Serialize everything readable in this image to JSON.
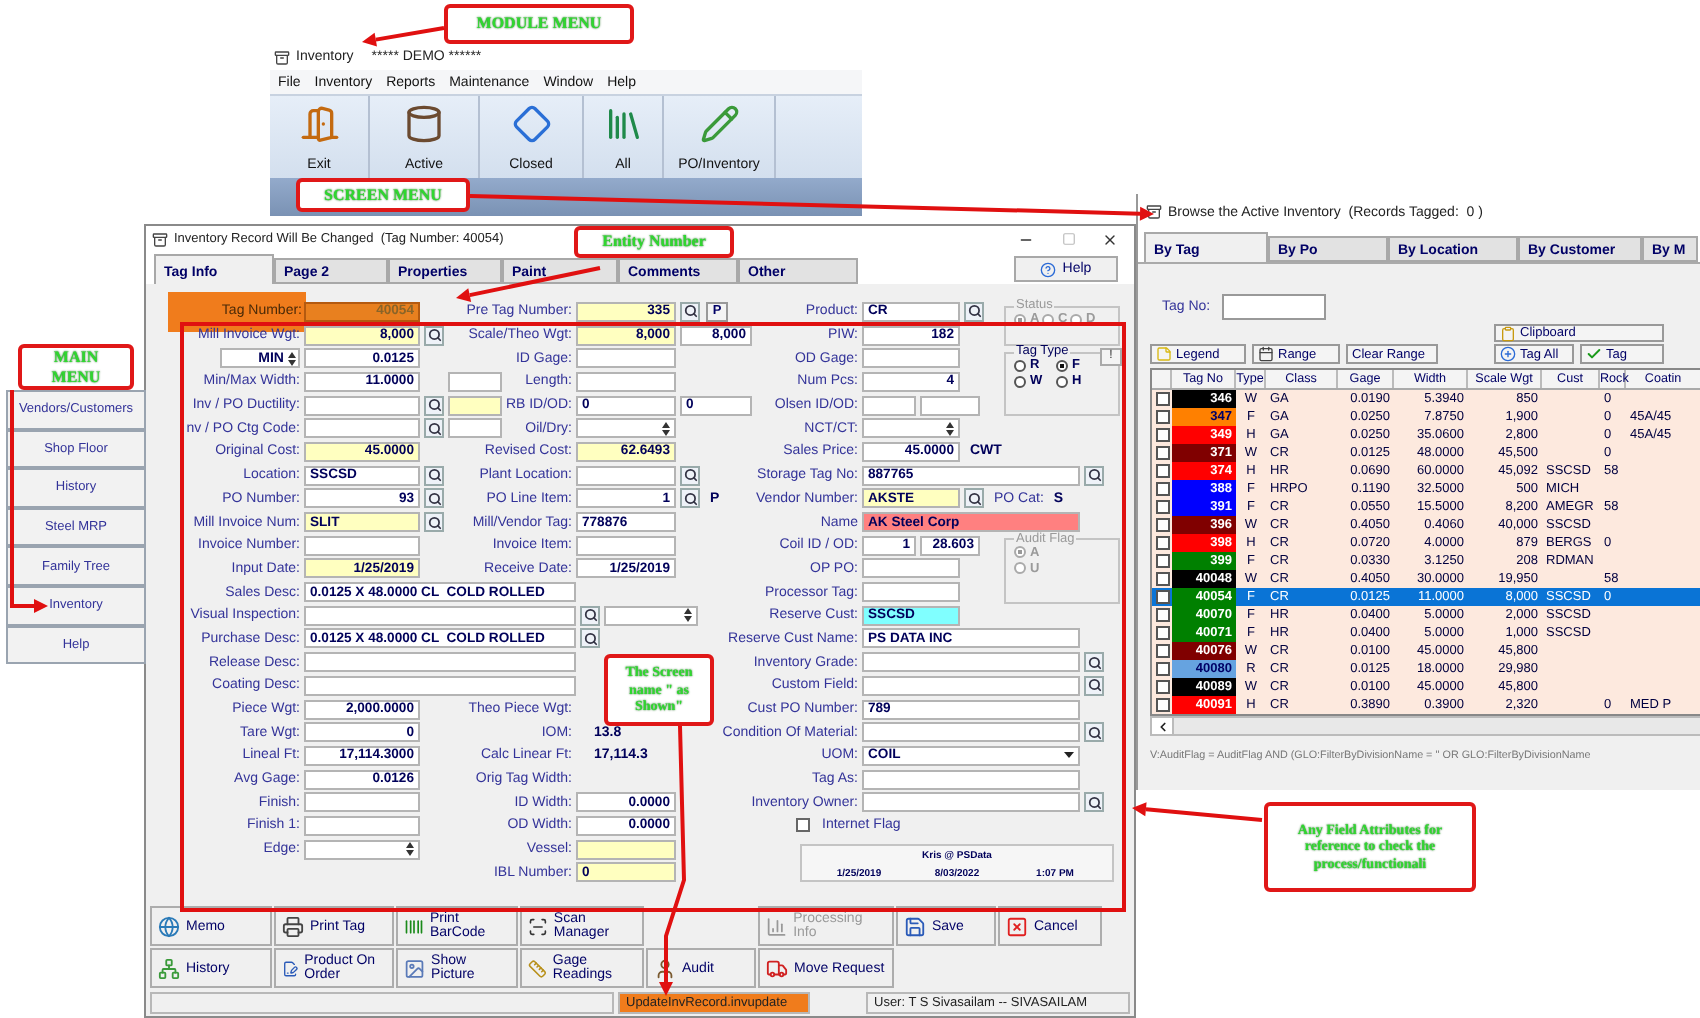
{
  "annotations": [
    {
      "text": "MODULE MENU"
    },
    {
      "text": "SCREEN MENU"
    },
    {
      "text": "Entity Number"
    },
    {
      "text": "MAIN MENU"
    },
    {
      "text": "The Screen name \" as Shown\""
    },
    {
      "text": "Any Field Attributes for reference to check the process/functionali"
    }
  ],
  "module_window": {
    "title": "Inventory",
    "subtitle": "***** DEMO ******",
    "menu": [
      "File",
      "Inventory",
      "Reports",
      "Maintenance",
      "Window",
      "Help"
    ],
    "toolbar": [
      "Exit",
      "Active",
      "Closed",
      "All",
      "PO/Inventory"
    ]
  },
  "main_menu": [
    "Vendors/Customers",
    "Shop Floor",
    "History",
    "Steel MRP",
    "Family Tree",
    "Inventory",
    "Help"
  ],
  "form": {
    "title": "Inventory Record Will Be Changed  (Tag Number: 40054)",
    "tabs": [
      {
        "label": "Tag Info",
        "selected": true
      },
      {
        "label": "Page 2",
        "selected": false
      },
      {
        "label": "Properties",
        "selected": false
      },
      {
        "label": "Paint",
        "selected": false
      },
      {
        "label": "Comments",
        "selected": false
      },
      {
        "label": "Other",
        "selected": false
      }
    ],
    "help": "Help",
    "rows": [
      {
        "left": {
          "label": "Tag Number:",
          "value": "40054",
          "kind": "tag"
        },
        "middle": {
          "label": "Pre Tag Number:",
          "value": "335",
          "kind": "number",
          "color": "#ffffc0",
          "lookup": true,
          "button": "P"
        },
        "right": {
          "label": "Product:",
          "value": "CR",
          "kind": "text",
          "lookup": true
        }
      },
      {
        "left": {
          "label": "Mill Invoice Wgt:",
          "value": "8,000",
          "kind": "number",
          "color": "#ffffc0",
          "lookup": true
        },
        "middle": {
          "label": "Scale/Theo Wgt:",
          "value": "8,000",
          "kind": "number",
          "color": "#ffffc0",
          "second": {
            "value": "8,000",
            "kind": "number"
          }
        },
        "right": {
          "label": "PIW:",
          "value": "182",
          "kind": "number"
        }
      },
      {
        "left": {
          "selector": "MIN",
          "value": "0.0125",
          "kind": "number"
        },
        "middle": {
          "label": "ID Gage:",
          "kind": "text"
        },
        "right": {
          "label": "OD Gage:",
          "kind": "text"
        }
      },
      {
        "left": {
          "label": "Min/Max Width:",
          "value": "11.0000",
          "kind": "number",
          "second": {
            "kind": "text"
          }
        },
        "middle": {
          "label": "Length:",
          "kind": "text"
        },
        "right": {
          "label": "Num Pcs:",
          "value": "4",
          "kind": "number"
        }
      },
      {
        "left": {
          "label": "Inv / PO Ductility:",
          "kind": "text",
          "lookup": true,
          "second": {
            "kind": "text",
            "color": "#ffffc0"
          }
        },
        "middle": {
          "label": "RB ID/OD:",
          "value": "0",
          "kind": "text",
          "second": {
            "value": "0",
            "kind": "text"
          }
        },
        "right": {
          "label": "Olsen ID/OD:",
          "kind": "text",
          "second": {
            "kind": "text"
          }
        }
      },
      {
        "left": {
          "label": "nv / PO Ctg Code:",
          "kind": "text",
          "lookup": true,
          "second": {
            "kind": "text"
          }
        },
        "middle": {
          "label": "Oil/Dry:",
          "kind": "spin"
        },
        "right": {
          "label": "NCT/CT:",
          "kind": "spin"
        }
      },
      {
        "left": {
          "label": "Original Cost:",
          "value": "45.0000",
          "kind": "number",
          "color": "#ffffc0"
        },
        "middle": {
          "label": "Revised Cost:",
          "value": "62.6493",
          "kind": "number",
          "color": "#ffffc0"
        },
        "right": {
          "label": "Sales Price:",
          "value": "45.0000",
          "kind": "number",
          "suffixes": [
            {
              "text": "CWT",
              "kind": "value"
            }
          ]
        }
      },
      {
        "left": {
          "label": "Location:",
          "value": "SSCSD",
          "kind": "text",
          "lookup": true
        },
        "middle": {
          "label": "Plant Location:",
          "kind": "text",
          "lookup": true
        },
        "right": {
          "label": "Storage Tag No:",
          "value": "887765",
          "kind": "long",
          "lookup": true
        }
      },
      {
        "left": {
          "label": "PO Number:",
          "value": "93",
          "kind": "number",
          "lookup": true
        },
        "middle": {
          "label": "PO Line Item:",
          "value": "1",
          "kind": "number",
          "lookup": true,
          "suffixes": [
            {
              "text": "P",
              "kind": "value"
            }
          ]
        },
        "right": {
          "label": "Vendor Number:",
          "value": "AKSTE",
          "kind": "text",
          "color": "#ffffc0",
          "lookup": true,
          "suffixes": [
            {
              "text": "PO Cat:",
              "kind": "label"
            },
            {
              "text": "S",
              "kind": "value"
            }
          ]
        }
      },
      {
        "left": {
          "label": "Mill Invoice Num:",
          "value": "SLIT",
          "kind": "text",
          "color": "#ffffc0",
          "lookup": true
        },
        "middle": {
          "label": "Mill/Vendor Tag:",
          "value": "778876",
          "kind": "text"
        },
        "right": {
          "label": "Name",
          "value": "AK Steel Corp",
          "kind": "long",
          "color": "#ff8080"
        }
      },
      {
        "left": {
          "label": "Invoice Number:",
          "kind": "text"
        },
        "middle": {
          "label": "Invoice Item:",
          "kind": "text"
        },
        "right": {
          "label": "Coil ID / OD:",
          "value": "1",
          "kind": "number",
          "second": {
            "value": "28.603",
            "kind": "number"
          }
        }
      },
      {
        "left": {
          "label": "Input Date:",
          "value": "1/25/2019",
          "kind": "number",
          "color": "#ffffc0"
        },
        "middle": {
          "label": "Receive Date:",
          "value": "1/25/2019",
          "kind": "number"
        },
        "right": {
          "label": "OP PO:",
          "kind": "text"
        }
      },
      {
        "left": {
          "label": "Sales Desc:",
          "value": "0.0125 X 48.0000 CL  COLD ROLLED",
          "kind": "wide"
        },
        "right": {
          "label": "Processor Tag:",
          "kind": "text"
        }
      },
      {
        "left": {
          "label": "Visual Inspection:",
          "kind": "wide",
          "lookup": true,
          "second": {
            "kind": "spin"
          }
        },
        "right": {
          "label": "Reserve Cust:",
          "value": "SSCSD",
          "kind": "text",
          "color": "#80ffff"
        }
      },
      {
        "left": {
          "label": "Purchase Desc:",
          "value": "0.0125 X 48.0000 CL  COLD ROLLED",
          "kind": "wide",
          "lookup": true
        },
        "right": {
          "label": "Reserve Cust Name:",
          "value": "PS DATA INC",
          "kind": "long"
        }
      },
      {
        "left": {
          "label": "Release Desc:",
          "kind": "wide"
        },
        "right": {
          "label": "Inventory Grade:",
          "kind": "long",
          "lookup": true
        }
      },
      {
        "left": {
          "label": "Coating Desc:",
          "kind": "wide"
        },
        "right": {
          "label": "Custom Field:",
          "kind": "long",
          "lookup": true
        }
      },
      {
        "left": {
          "label": "Piece Wgt:",
          "value": "2,000.0000",
          "kind": "number"
        },
        "middle": {
          "label": "Theo Piece Wgt:",
          "kind": "plain"
        },
        "right": {
          "label": "Cust PO Number:",
          "value": "789",
          "kind": "long"
        }
      },
      {
        "left": {
          "label": "Tare Wgt:",
          "value": "0",
          "kind": "number"
        },
        "middle": {
          "label": "IOM:",
          "value": "13.8",
          "kind": "plain"
        },
        "right": {
          "label": "Condition Of Material:",
          "kind": "long",
          "lookup": true
        }
      },
      {
        "left": {
          "label": "Lineal Ft:",
          "value": "17,114.3000",
          "kind": "number"
        },
        "middle": {
          "label": "Calc Linear Ft:",
          "value": "17,114.3",
          "kind": "plain"
        },
        "right": {
          "label": "UOM:",
          "value": "COIL",
          "kind": "combo"
        }
      },
      {
        "left": {
          "label": "Avg Gage:",
          "value": "0.0126",
          "kind": "number"
        },
        "middle": {
          "label": "Orig Tag Width:",
          "kind": "plain"
        },
        "right": {
          "label": "Tag As:",
          "kind": "long"
        }
      },
      {
        "left": {
          "label": "Finish:",
          "kind": "text"
        },
        "middle": {
          "label": "ID Width:",
          "value": "0.0000",
          "kind": "number"
        },
        "right": {
          "label": "Inventory Owner:",
          "kind": "long",
          "lookup": true
        }
      },
      {
        "left": {
          "label": "Finish 1:",
          "kind": "text"
        },
        "middle": {
          "label": "OD Width:",
          "value": "0.0000",
          "kind": "number"
        },
        "right": {
          "label": "Internet Flag",
          "kind": "check",
          "checked": false
        }
      },
      {
        "left": {
          "label": "Edge:",
          "kind": "spin"
        },
        "middle": {
          "label": "Vessel:",
          "kind": "text",
          "color": "#ffffc0"
        }
      },
      {
        "middle": {
          "label": "IBL Number:",
          "value": "0",
          "kind": "text",
          "color": "#ffffc0"
        }
      }
    ],
    "groups": [
      {
        "title": "Status",
        "disabled": true,
        "options": [
          {
            "label": "A",
            "selected": true
          },
          {
            "label": "C",
            "selected": false
          },
          {
            "label": "D",
            "selected": false
          }
        ]
      },
      {
        "title": "Tag Type",
        "disabled": false,
        "button": "!",
        "options": [
          {
            "label": "R",
            "selected": false
          },
          {
            "label": "F",
            "selected": true
          },
          {
            "label": "W",
            "selected": false
          },
          {
            "label": "H",
            "selected": false
          }
        ]
      },
      {
        "title": "Audit Flag",
        "disabled": true,
        "options": [
          {
            "label": "A",
            "selected": true
          },
          {
            "label": "U",
            "selected": false
          }
        ]
      }
    ],
    "record_info": {
      "user": "Kris @ PSData",
      "created": "1/25/2019",
      "changed": "8/03/2022",
      "time": "1:07 PM"
    },
    "buttons": [
      [
        {
          "label": "Memo",
          "disabled": false
        },
        {
          "label": "Print Tag",
          "disabled": false
        },
        {
          "label": "Print BarCode",
          "disabled": false
        },
        {
          "label": "Scan Manager",
          "disabled": false
        },
        {
          "label": "Processing Info",
          "disabled": true
        },
        {
          "label": "Save",
          "disabled": false
        },
        {
          "label": "Cancel",
          "disabled": false
        }
      ],
      [
        {
          "label": "History",
          "disabled": false
        },
        {
          "label": "Product On Order",
          "disabled": false
        },
        {
          "label": "Show Picture",
          "disabled": false
        },
        {
          "label": "Gage Readings",
          "disabled": false
        },
        {
          "label": "Audit",
          "disabled": false
        },
        {
          "label": "Move Request",
          "disabled": false
        }
      ]
    ],
    "status_bar": {
      "screen": "UpdateInvRecord.invupdate",
      "user": "User: T S Sivasailam -- SIVASAILAM"
    }
  },
  "browse": {
    "title": "Browse the Active Inventory  (Records Tagged:  0 )",
    "tabs": [
      {
        "label": "By Tag",
        "selected": true
      },
      {
        "label": "By Po",
        "selected": false
      },
      {
        "label": "By Location",
        "selected": false
      },
      {
        "label": "By Customer",
        "selected": false
      },
      {
        "label": "By M",
        "selected": false
      }
    ],
    "tag_no_label": "Tag No:",
    "buttons": [
      "Clipboard",
      "Legend",
      "Range",
      "Clear Range",
      "Tag All",
      "Tag"
    ],
    "table": {
      "columns": [
        "Tag No",
        "Type",
        "Class",
        "Gage",
        "Width",
        "Scale Wgt",
        "Cust",
        "Rock",
        "Coatin"
      ],
      "rows": [
        {
          "color": "#000000",
          "checked": false,
          "selected": false,
          "cells": [
            "346",
            "W",
            "GA",
            "0.0190",
            "5.3940",
            "850",
            null,
            "0",
            null
          ]
        },
        {
          "color": "#ff8000",
          "checked": false,
          "selected": false,
          "cells": [
            "347",
            "F",
            "GA",
            "0.0250",
            "7.8750",
            "1,900",
            null,
            "0",
            "45A/45"
          ]
        },
        {
          "color": "#ff0000",
          "checked": false,
          "selected": false,
          "cells": [
            "349",
            "H",
            "GA",
            "0.0250",
            "35.0600",
            "2,800",
            null,
            "0",
            "45A/45"
          ]
        },
        {
          "color": "#800000",
          "checked": false,
          "selected": false,
          "cells": [
            "371",
            "W",
            "CR",
            "0.0125",
            "48.0000",
            "45,500",
            null,
            "0",
            null
          ]
        },
        {
          "color": "#ff0000",
          "checked": false,
          "selected": false,
          "cells": [
            "374",
            "H",
            "HR",
            "0.0690",
            "60.0000",
            "45,092",
            "SSCSD",
            "58",
            null
          ]
        },
        {
          "color": "#0000ff",
          "checked": false,
          "selected": false,
          "cells": [
            "388",
            "F",
            "HRPO",
            "0.1190",
            "32.5000",
            "500",
            "MICH",
            null,
            null
          ]
        },
        {
          "color": "#0000ff",
          "checked": false,
          "selected": false,
          "cells": [
            "391",
            "F",
            "CR",
            "0.0550",
            "15.5000",
            "8,200",
            "AMEGR",
            "58",
            null
          ]
        },
        {
          "color": "#800000",
          "checked": false,
          "selected": false,
          "cells": [
            "396",
            "W",
            "CR",
            "0.4050",
            "0.4060",
            "40,000",
            "SSCSD",
            null,
            null
          ]
        },
        {
          "color": "#ff0000",
          "checked": false,
          "selected": false,
          "cells": [
            "398",
            "H",
            "CR",
            "0.0720",
            "4.0000",
            "879",
            "BERGS",
            "0",
            null
          ]
        },
        {
          "color": "#008000",
          "checked": false,
          "selected": false,
          "cells": [
            "399",
            "F",
            "CR",
            "0.0330",
            "3.1250",
            "208",
            "RDMAN",
            null,
            null
          ]
        },
        {
          "color": "#000000",
          "checked": false,
          "selected": false,
          "cells": [
            "40048",
            "W",
            "CR",
            "0.4050",
            "30.0000",
            "19,950",
            null,
            "58",
            null
          ]
        },
        {
          "color": "#008000",
          "checked": false,
          "selected": true,
          "cells": [
            "40054",
            "F",
            "CR",
            "0.0125",
            "11.0000",
            "8,000",
            "SSCSD",
            "0",
            null
          ]
        },
        {
          "color": "#008000",
          "checked": false,
          "selected": false,
          "cells": [
            "40070",
            "F",
            "HR",
            "0.0400",
            "5.0000",
            "2,000",
            "SSCSD",
            null,
            null
          ]
        },
        {
          "color": "#008000",
          "checked": false,
          "selected": false,
          "cells": [
            "40071",
            "F",
            "HR",
            "0.0400",
            "5.0000",
            "1,000",
            "SSCSD",
            null,
            null
          ]
        },
        {
          "color": "#800000",
          "checked": false,
          "selected": false,
          "cells": [
            "40076",
            "W",
            "CR",
            "0.0100",
            "45.0000",
            "45,800",
            null,
            null,
            null
          ]
        },
        {
          "color": "#66a3e0",
          "checked": false,
          "selected": false,
          "cells": [
            "40080",
            "R",
            "CR",
            "0.0125",
            "18.0000",
            "29,980",
            null,
            null,
            null
          ]
        },
        {
          "color": "#000000",
          "checked": false,
          "selected": false,
          "cells": [
            "40089",
            "W",
            "CR",
            "0.0100",
            "45.0000",
            "45,800",
            null,
            null,
            null
          ]
        },
        {
          "color": "#ff0000",
          "checked": false,
          "selected": false,
          "cells": [
            "40091",
            "H",
            "CR",
            "0.3890",
            "0.3900",
            "2,320",
            null,
            "0",
            "MED P"
          ]
        }
      ]
    },
    "filter": "V:AuditFlag = AuditFlag AND (GLO:FilterByDivisionName = '' OR GLO:FilterByDivisionName"
  }
}
